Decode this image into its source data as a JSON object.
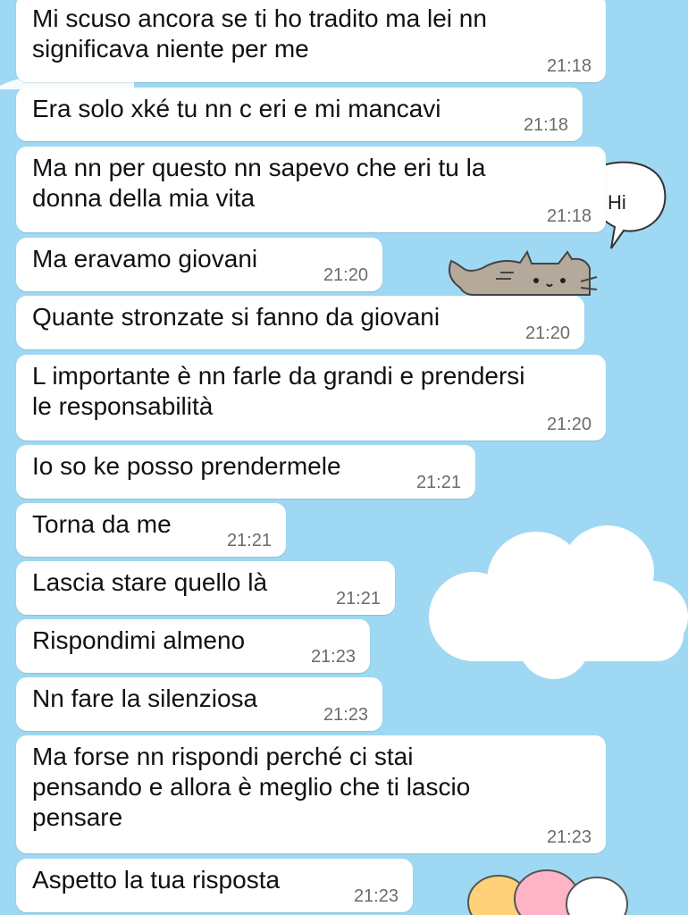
{
  "colors": {
    "background": "#9fd8f2",
    "bubble": "#ffffff",
    "text": "#111111",
    "timestamp": "#6b6b6b"
  },
  "decorations": {
    "speech_bubble_text": "Hi",
    "icons": [
      "speech-bubble-icon",
      "pusheen-cat-icon",
      "cloud-icon",
      "balloons-icon"
    ]
  },
  "messages": [
    {
      "text": "Mi scuso ancora se ti ho tradito ma lei nn\nsignificava niente per me",
      "time": "21:18"
    },
    {
      "text": "Era solo xké tu nn c eri e mi mancavi",
      "time": "21:18"
    },
    {
      "text": "Ma nn per questo nn sapevo che eri tu la\ndonna della mia vita",
      "time": "21:18"
    },
    {
      "text": "Ma eravamo giovani",
      "time": "21:20"
    },
    {
      "text": "Quante stronzate si fanno da giovani",
      "time": "21:20"
    },
    {
      "text": "L importante è nn farle da grandi e prendersi\nle responsabilità",
      "time": "21:20"
    },
    {
      "text": "Io so ke posso prendermele",
      "time": "21:21"
    },
    {
      "text": "Torna da me",
      "time": "21:21"
    },
    {
      "text": "Lascia stare quello là",
      "time": "21:21"
    },
    {
      "text": "Rispondimi almeno",
      "time": "21:23"
    },
    {
      "text": "Nn fare la silenziosa",
      "time": "21:23"
    },
    {
      "text": "Ma forse nn rispondi perché ci stai\npensando e allora è meglio che ti lascio\npensare",
      "time": "21:23"
    },
    {
      "text": "Aspetto la tua risposta",
      "time": "21:23"
    }
  ]
}
